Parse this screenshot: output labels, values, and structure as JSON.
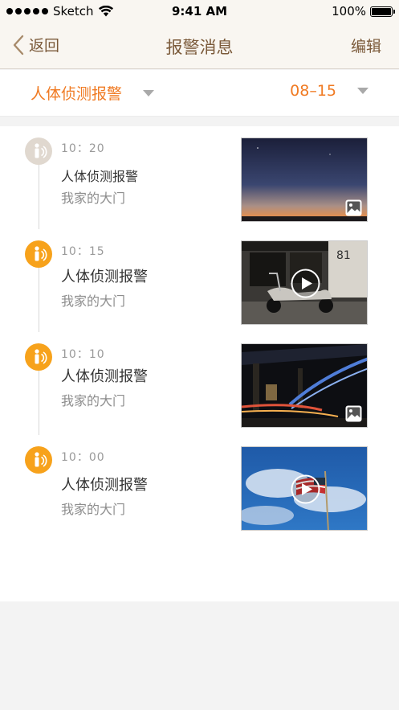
{
  "status_bar": {
    "carrier": "Sketch",
    "time": "9:41 AM",
    "battery": "100%"
  },
  "nav": {
    "back_label": "返回",
    "title": "报警消息",
    "edit_label": "编辑"
  },
  "filter": {
    "type_label": "人体侦测报警",
    "date_label": "08–15"
  },
  "alerts": [
    {
      "time": "10：20",
      "title": "人体侦测报警",
      "location": "我家的大门",
      "media": "photo",
      "read": true
    },
    {
      "time": "10：15",
      "title": "人体侦测报警",
      "location": "我家的大门",
      "media": "video",
      "read": false
    },
    {
      "time": "10：10",
      "title": "人体侦测报警",
      "location": "我家的大门",
      "media": "photo",
      "read": false
    },
    {
      "time": "10：00",
      "title": "人体侦测报警",
      "location": "我家的大门",
      "media": "video",
      "read": false
    }
  ],
  "colors": {
    "accent": "#f07a22",
    "brown": "#7b5a3a",
    "alert_icon": "#f7a21b",
    "alert_icon_read": "#e0d8cf"
  },
  "icons": [
    "back-chevron-icon",
    "caret-down-icon",
    "motion-sensor-icon",
    "photo-icon",
    "play-icon"
  ]
}
